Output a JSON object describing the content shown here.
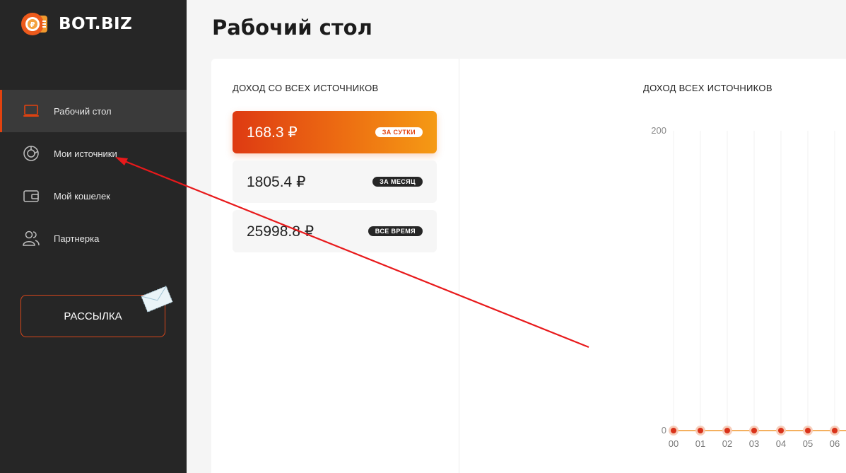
{
  "app": {
    "brand": "BOT.BIZ",
    "accent_color": "#e2420f"
  },
  "sidebar": {
    "items": [
      {
        "label": "Рабочий стол",
        "icon": "laptop-icon",
        "active": true
      },
      {
        "label": "Мои источники",
        "icon": "pie-chart-icon",
        "active": false
      },
      {
        "label": "Мой кошелек",
        "icon": "wallet-icon",
        "active": false
      },
      {
        "label": "Партнерка",
        "icon": "users-icon",
        "active": false
      }
    ],
    "mailing_button": "РАССЫЛКА"
  },
  "page": {
    "title": "Рабочий стол"
  },
  "income": {
    "title": "ДОХОД СО ВСЕХ ИСТОЧНИКОВ",
    "stats": [
      {
        "value": "168.3 ₽",
        "badge": "ЗА СУТКИ"
      },
      {
        "value": "1805.4 ₽",
        "badge": "ЗА МЕСЯЦ"
      },
      {
        "value": "25998.8 ₽",
        "badge": "ВСЕ ВРЕМЯ"
      }
    ]
  },
  "chart": {
    "title": "ДОХОД ВСЕХ ИСТОЧНИКОВ"
  },
  "chart_data": {
    "type": "line",
    "title": "ДОХОД ВСЕХ ИСТОЧНИКОВ",
    "x": [
      "00",
      "01",
      "02",
      "03",
      "04",
      "05",
      "06"
    ],
    "series": [
      {
        "values": [
          0,
          0,
          0,
          0,
          0,
          0,
          0
        ]
      }
    ],
    "y_ticks": [
      "200",
      "0"
    ],
    "ylim": [
      0,
      200
    ],
    "grid": true,
    "line_color": "#f0952a",
    "point_color": "#d9321a"
  }
}
